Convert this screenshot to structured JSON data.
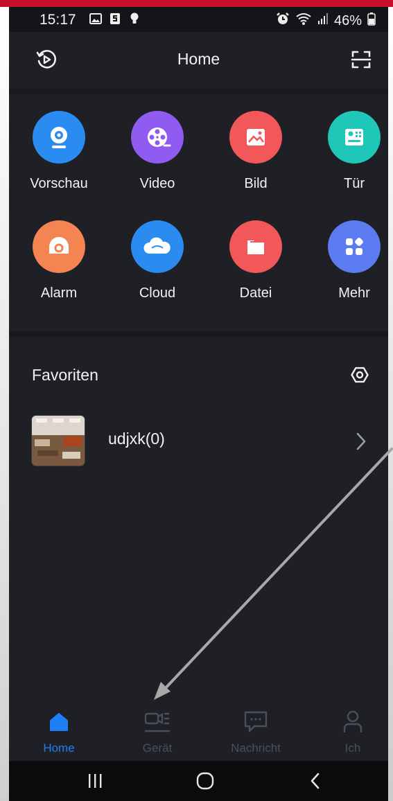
{
  "status_bar": {
    "time": "15:17",
    "battery": "46%"
  },
  "header": {
    "title": "Home"
  },
  "grid": [
    {
      "label": "Vorschau",
      "icon": "camera-icon",
      "color": "#2a8cf0"
    },
    {
      "label": "Video",
      "icon": "film-reel-icon",
      "color": "#8f5bf0"
    },
    {
      "label": "Bild",
      "icon": "image-icon",
      "color": "#f2575a"
    },
    {
      "label": "Tür",
      "icon": "door-intercom-icon",
      "color": "#1fc7b8"
    },
    {
      "label": "Alarm",
      "icon": "alarm-icon",
      "color": "#f48553"
    },
    {
      "label": "Cloud",
      "icon": "cloud-icon",
      "color": "#2a8cf0"
    },
    {
      "label": "Datei",
      "icon": "folder-icon",
      "color": "#f2575a"
    },
    {
      "label": "Mehr",
      "icon": "more-apps-icon",
      "color": "#5b7cf0"
    }
  ],
  "favorites": {
    "title": "Favoriten",
    "items": [
      {
        "name": "udjxk(0)"
      }
    ]
  },
  "bottom_nav": {
    "active_color": "#1e7ff5",
    "items": [
      {
        "label": "Home",
        "icon": "home-icon",
        "active": true
      },
      {
        "label": "Gerät",
        "icon": "device-icon",
        "active": false
      },
      {
        "label": "Nachricht",
        "icon": "message-icon",
        "active": false
      },
      {
        "label": "Ich",
        "icon": "profile-icon",
        "active": false
      }
    ]
  }
}
